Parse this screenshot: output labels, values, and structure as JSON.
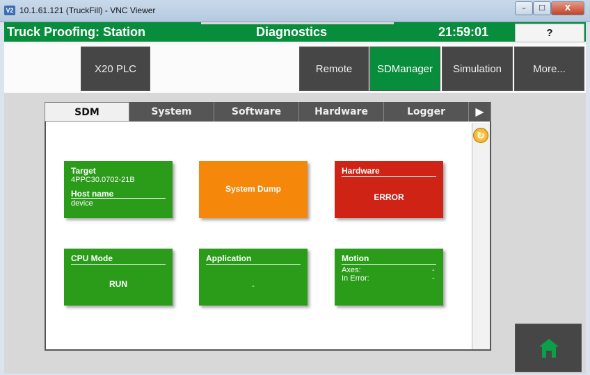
{
  "window": {
    "icon_text": "V2",
    "title": "10.1.61.121 (TruckFill) - VNC Viewer",
    "minimize": "–",
    "maximize": "☐",
    "close": "X"
  },
  "header": {
    "station": "Truck Proofing: Station",
    "screen": "Diagnostics",
    "clock": "21:59:01",
    "help": "?"
  },
  "nav": {
    "x20": "X20 PLC",
    "remote": "Remote",
    "sdm": "SDManager",
    "simulation": "Simulation",
    "more": "More..."
  },
  "tabs": [
    "SDM",
    "System",
    "Software",
    "Hardware",
    "Logger"
  ],
  "tab_arrow": "▶",
  "refresh_icon": "↻",
  "tiles": {
    "target": {
      "title": "Target",
      "value": "4PPC30.0702-21B",
      "host_label": "Host name",
      "host_value": "device"
    },
    "dump": {
      "label": "System Dump"
    },
    "hardware": {
      "title": "Hardware",
      "status": "ERROR"
    },
    "cpu": {
      "title": "CPU Mode",
      "status": "RUN"
    },
    "application": {
      "title": "Application",
      "value": "-"
    },
    "motion": {
      "title": "Motion",
      "axes_label": "Axes:",
      "axes_value": "-",
      "error_label": "In Error:",
      "error_value": "-"
    }
  },
  "colors": {
    "header_green": "#078d3c",
    "tile_green": "#2b9b1a",
    "tile_orange": "#f5870b",
    "tile_red": "#cf2316",
    "nav_dark": "#464646"
  }
}
